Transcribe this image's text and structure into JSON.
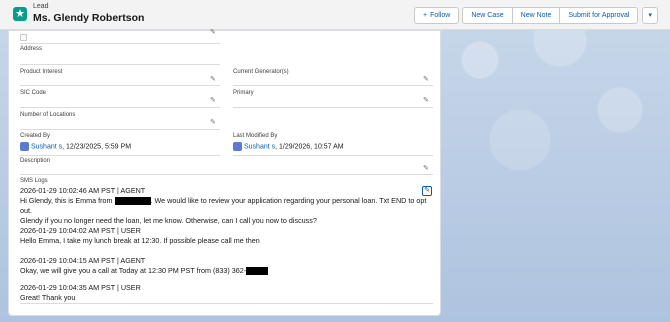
{
  "header": {
    "object_type": "Lead",
    "record_name": "Ms. Glendy Robertson",
    "follow_label": "Follow",
    "actions": [
      "New Case",
      "New Note",
      "Submit for Approval"
    ]
  },
  "fields": {
    "address_label": "Address",
    "product_interest_label": "Product Interest",
    "current_generator_label": "Current Generator(s)",
    "sic_code_label": "SIC Code",
    "primary_label": "Primary",
    "number_of_locations_label": "Number of Locations",
    "created_by_label": "Created By",
    "created_by_user": "Sushant s",
    "created_by_date": ", 12/23/2025, 5:59 PM",
    "last_modified_by_label": "Last Modified By",
    "last_modified_by_user": "Sushant s",
    "last_modified_date": ", 1/29/2026, 10:57 AM",
    "description_label": "Description",
    "sms_logs_label": "SMS Logs"
  },
  "sms_logs": [
    {
      "header": "2026-01-29 10:02:46 AM PST | AGENT",
      "line1a": "Hi Glendy, this is Emma from",
      "line1b": ". We would like to review your application regarding your personal loan. Txt END to opt out.",
      "line2": "Glendy if you no longer need the loan, let me know. Otherwise, can I call you now to discuss?"
    },
    {
      "header": "2026-01-29 10:04:02 AM PST | USER",
      "line1": "Hello Emma, I take my lunch break at 12:30. If possible please call me then"
    },
    {
      "header": "2026-01-29 10:04:15 AM PST | AGENT",
      "line1": "Okay, we will give you a call at Today at 12:30 PM PST from (833) 362-"
    },
    {
      "header": "2026-01-29 10:04:35 AM PST | USER",
      "line1": "Great! Thank you"
    }
  ],
  "colors": {
    "brand_link": "#0b5cab",
    "lead_icon": "#0b9b8a",
    "background": "#b6c9e2"
  },
  "icons": {
    "lead": "star-icon",
    "edit": "pencil-icon",
    "menu": "chevron-down-icon"
  }
}
